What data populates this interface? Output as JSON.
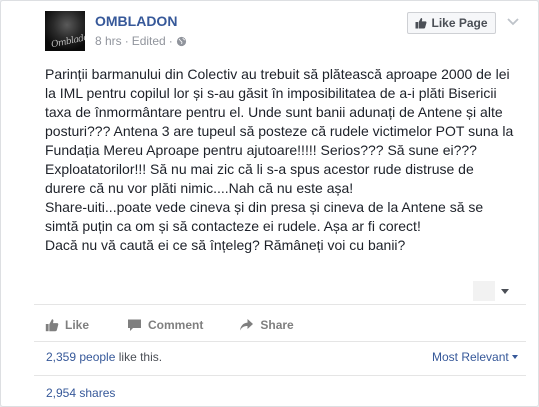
{
  "post": {
    "page_name": "OMBLADON",
    "time": "8 hrs",
    "meta_sep": "·",
    "edited": "Edited",
    "like_page_label": "Like Page",
    "avatar_signature": "Ombladon",
    "paragraph_1": "Parinții barmanului din Colectiv au trebuit să plătească aproape 2000 de lei la IML pentru copilul lor și s-au găsit în imposibilitatea de a-i plăti Bisericii taxa de înmormântare pentru el. Unde sunt banii adunați de Antene și alte posturi??? Antena 3 are tupeul să posteze că rudele victimelor POT suna la Fundația Mereu Aproape pentru ajutoare!!!!! Serios??? Să sune ei??? Exploatatorilor!!! Să nu mai zic că li s-a spus acestor rude distruse de durere că nu vor plăti nimic....Nah că nu este așa!",
    "paragraph_2": "Share-uiti...poate vede cineva și din presa și cineva de la Antene să se simtă puțin ca om și să contacteze ei rudele. Așa ar fi corect!",
    "paragraph_3": "Dacă nu vă caută ei ce să înțeleg? Rămâneți voi cu banii?"
  },
  "actions": {
    "like_label": "Like",
    "comment_label": "Comment",
    "share_label": "Share"
  },
  "stats": {
    "likes_count": "2,359 people",
    "likes_suffix": " like this.",
    "sort_label": "Most Relevant",
    "shares": "2,954 shares"
  },
  "icons": {
    "globe": "globe-icon",
    "thumbs_up": "thumbs-up-icon",
    "comment": "comment-icon",
    "share": "share-icon",
    "chevron": "chevron-down-icon"
  },
  "colors": {
    "link": "#365899",
    "text": "#1d2129",
    "meta": "#90949c",
    "action": "#7f7f7f"
  }
}
